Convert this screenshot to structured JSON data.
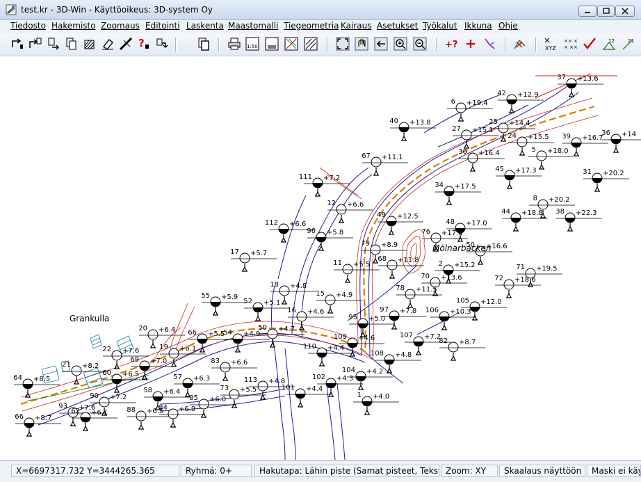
{
  "window": {
    "title": "test.kr - 3D-Win - Käyttöoikeus: 3D-system Oy",
    "buttons": [
      "minimize",
      "maximize",
      "close"
    ]
  },
  "menu": {
    "items": [
      "Tiedosto",
      "Hakemisto",
      "Zoomaus",
      "Editointi",
      "Laskenta",
      "Maastomalli",
      "Tiegeometria",
      "Kairaus",
      "Asetukset",
      "Työkalut",
      "Ikkuna",
      "Ohje"
    ]
  },
  "toolbar": {
    "icons": [
      "open-point-icon",
      "open-points-icon",
      "copy-points-icon",
      "new-points-icon",
      "hatch-points-icon",
      "erase-points-icon",
      "line-points-icon",
      "query-points-icon",
      "move-points-icon",
      "copy-icon",
      "print-icon",
      "scale-print-icon",
      "print-area-icon",
      "plot-icon",
      "plot-hatch-icon",
      "zoom-extents-icon",
      "zoom-pan-icon",
      "zoom-previous-icon",
      "zoom-in-icon",
      "zoom-out-icon",
      "query-point-icon",
      "add-point-icon",
      "line-tool-icon",
      "pick-icon",
      "xyz-icon",
      "grid-points-icon",
      "check-points-icon",
      "number-points-icon",
      "renumber-icon"
    ],
    "scale_label": "1:50"
  },
  "map": {
    "place_labels": [
      "Grankulla",
      "Mölnarbacken"
    ],
    "points": [
      {
        "id": "37",
        "z": "+13.6",
        "f": true
      },
      {
        "id": "42",
        "z": "+12.9",
        "f": true
      },
      {
        "id": "6",
        "z": "+19.4",
        "f": false
      },
      {
        "id": "25",
        "z": "+14.4",
        "f": false
      },
      {
        "id": "40",
        "z": "+13.8",
        "f": true
      },
      {
        "id": "27",
        "z": "+15.1",
        "f": false
      },
      {
        "id": "24",
        "z": "+15.5",
        "f": false
      },
      {
        "id": "39",
        "z": "+16.7",
        "f": true
      },
      {
        "id": "36",
        "z": "+14",
        "f": true
      },
      {
        "id": "30",
        "z": "+16.4",
        "f": false
      },
      {
        "id": "5",
        "z": "+18.0",
        "f": false
      },
      {
        "id": "67",
        "z": "+11.1",
        "f": false
      },
      {
        "id": "45",
        "z": "+17.3",
        "f": true
      },
      {
        "id": "31",
        "z": "+20.2",
        "f": true
      },
      {
        "id": "111",
        "z": "+7.2",
        "f": true
      },
      {
        "id": "34",
        "z": "+17.5",
        "f": true
      },
      {
        "id": "8",
        "z": "+20.2",
        "f": false
      },
      {
        "id": "12",
        "z": "+6.6",
        "f": false
      },
      {
        "id": "44",
        "z": "+18.8",
        "f": true
      },
      {
        "id": "38",
        "z": "+22.3",
        "f": true
      },
      {
        "id": "49",
        "z": "+12.5",
        "f": true
      },
      {
        "id": "112",
        "z": "+6.6",
        "f": true
      },
      {
        "id": "48",
        "z": "+17.0",
        "f": true
      },
      {
        "id": "96",
        "z": "+5.8",
        "f": true
      },
      {
        "id": "76",
        "z": "+17.4",
        "f": false
      },
      {
        "id": "79",
        "z": "+8.9",
        "f": false
      },
      {
        "id": "50",
        "z": "+16.6",
        "f": false
      },
      {
        "id": "17",
        "z": "+5.7",
        "f": false
      },
      {
        "id": "68",
        "z": "+11.8",
        "f": false
      },
      {
        "id": "11",
        "z": "+5.5",
        "f": false
      },
      {
        "id": "2",
        "z": "+15.2",
        "f": true
      },
      {
        "id": "71",
        "z": "+19.5",
        "f": false
      },
      {
        "id": "70",
        "z": "+13.6",
        "f": false
      },
      {
        "id": "72",
        "z": "+18.6",
        "f": false
      },
      {
        "id": "18",
        "z": "+4.8",
        "f": false
      },
      {
        "id": "78",
        "z": "+11.5",
        "f": false
      },
      {
        "id": "55",
        "z": "+5.9",
        "f": true
      },
      {
        "id": "15",
        "z": "+4.9",
        "f": false
      },
      {
        "id": "52",
        "z": "+5.1",
        "f": true
      },
      {
        "id": "105",
        "z": "+12.0",
        "f": true
      },
      {
        "id": "97",
        "z": "+7.8",
        "f": true
      },
      {
        "id": "16",
        "z": "+4.6",
        "f": false
      },
      {
        "id": "106",
        "z": "+10.3",
        "f": true
      },
      {
        "id": "95",
        "z": "+5.0",
        "f": true
      },
      {
        "id": "20",
        "z": "+6.4",
        "f": false
      },
      {
        "id": "66",
        "z": "+5.5",
        "f": true
      },
      {
        "id": "54",
        "z": "+4.9",
        "f": true
      },
      {
        "id": "50",
        "z": "+4.7",
        "f": false
      },
      {
        "id": "107",
        "z": "+7.2",
        "f": true
      },
      {
        "id": "82",
        "z": "+8.7",
        "f": false
      },
      {
        "id": "109",
        "z": "+4.6",
        "f": true
      },
      {
        "id": "19",
        "z": "+6.1",
        "f": false
      },
      {
        "id": "110",
        "z": "+4.4",
        "f": true
      },
      {
        "id": "22",
        "z": "+7.6",
        "f": false
      },
      {
        "id": "108",
        "z": "+4.8",
        "f": true
      },
      {
        "id": "69",
        "z": "+7.0",
        "f": true
      },
      {
        "id": "83",
        "z": "+6.6",
        "f": false
      },
      {
        "id": "21",
        "z": "+8.2",
        "f": false
      },
      {
        "id": "60",
        "z": "+6.5",
        "f": true
      },
      {
        "id": "57",
        "z": "+6.3",
        "f": true
      },
      {
        "id": "104",
        "z": "+4.2",
        "f": true
      },
      {
        "id": "113",
        "z": "+4.8",
        "f": false
      },
      {
        "id": "102",
        "z": "+4.3",
        "f": true
      },
      {
        "id": "64",
        "z": "+8.5",
        "f": true
      },
      {
        "id": "58",
        "z": "+6.4",
        "f": true
      },
      {
        "id": "101",
        "z": "+4.4",
        "f": true
      },
      {
        "id": "73",
        "z": "+5.5",
        "f": false
      },
      {
        "id": "1",
        "z": "+4.0",
        "f": true
      },
      {
        "id": "90",
        "z": "+7.2",
        "f": false
      },
      {
        "id": "85",
        "z": "+6.0",
        "f": false
      },
      {
        "id": "93",
        "z": "+7.6",
        "f": false
      },
      {
        "id": "62",
        "z": "+6.1",
        "f": true
      },
      {
        "id": "88",
        "z": "+6.5",
        "f": false
      },
      {
        "id": "84",
        "z": "+6.9",
        "f": false
      },
      {
        "id": "66",
        "z": "+8.7",
        "f": true
      }
    ]
  },
  "status": {
    "coords": "X=6697317.732  Y=3444265.365",
    "group": "Ryhmä: 0+",
    "snap": "Hakutapa: Lähin piste (Samat pisteet, Tekstit)",
    "zoom": "Zoom: XY",
    "scaling": "Skaalaus näyttöön",
    "mask": "Maski ei käy"
  },
  "colors": {
    "road": "#1a1aa0",
    "alignment": "#e07800",
    "contour": "#cc2a18",
    "hatch": "#1a8a9a",
    "vegetation": "#2a8a2a"
  }
}
